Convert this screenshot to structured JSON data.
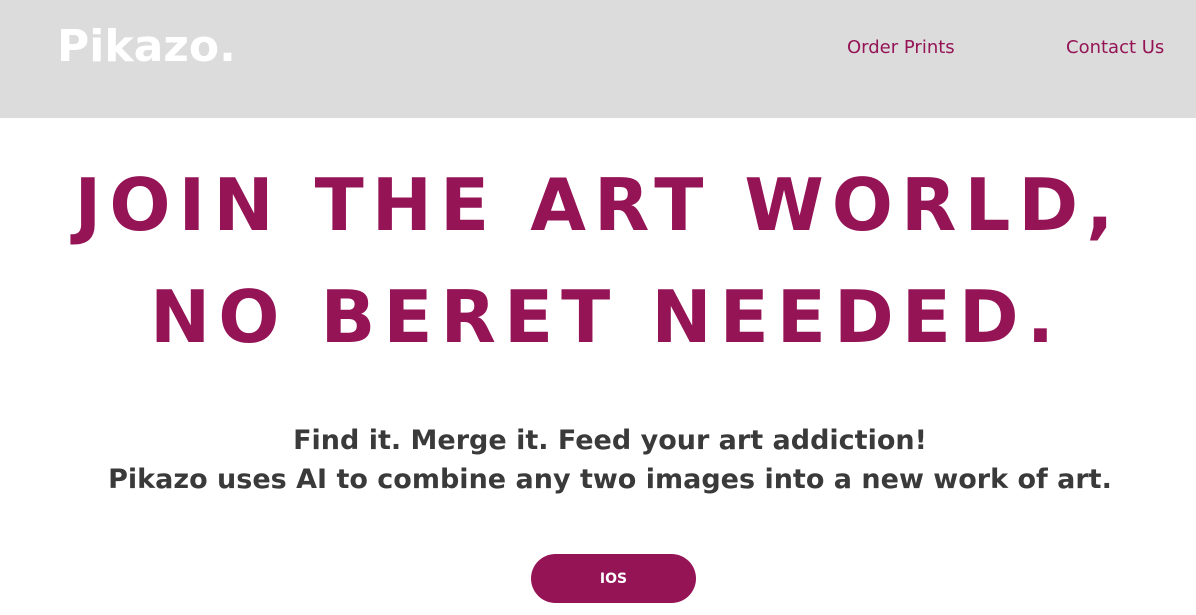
{
  "header": {
    "logo": "Pikazo.",
    "nav": {
      "order_prints": "Order Prints",
      "contact_us": "Contact Us"
    }
  },
  "hero": {
    "headline_line1": "JOIN THE ART WORLD,",
    "headline_line2": "NO BERET NEEDED.",
    "tagline_line1": "Find it. Merge it. Feed your art addiction!",
    "tagline_line2": "Pikazo uses AI to combine any two images into a new work of art.",
    "cta_ios": "IOS"
  },
  "colors": {
    "brand": "#951456",
    "header_bg": "#dcdcdc",
    "text_dark": "#3a3a3a"
  }
}
